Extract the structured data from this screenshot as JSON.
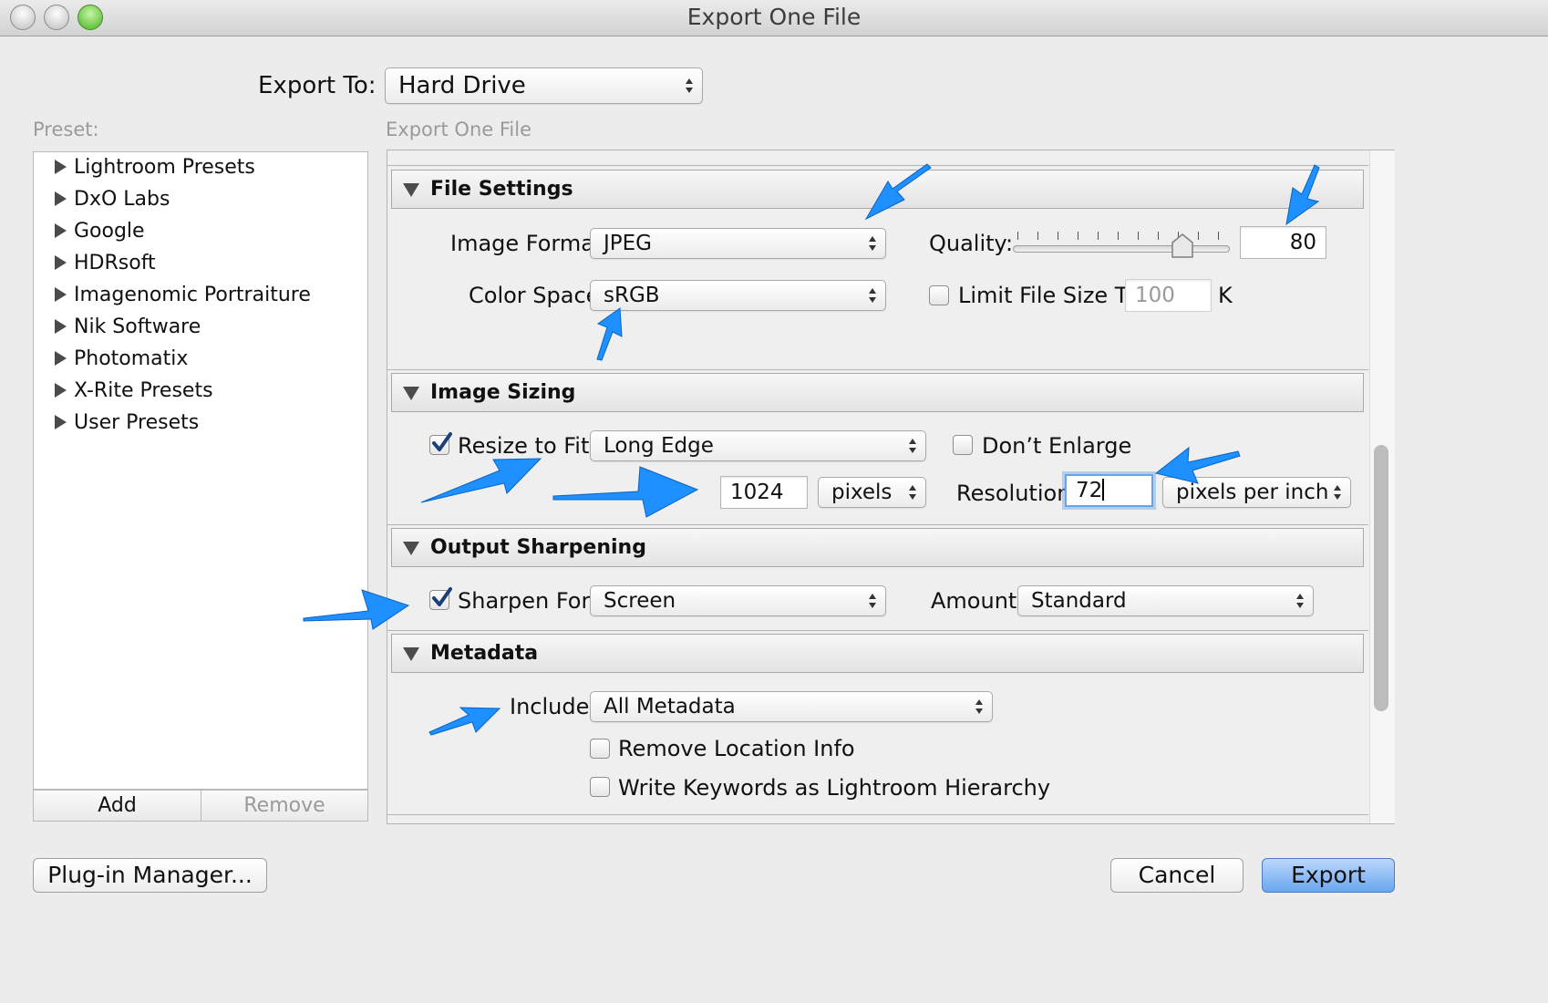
{
  "window": {
    "title": "Export One File"
  },
  "export_to": {
    "label": "Export To:",
    "value": "Hard Drive"
  },
  "preset": {
    "label": "Preset:",
    "items": [
      "Lightroom Presets",
      "DxO Labs",
      "Google",
      "HDRsoft",
      "Imagenomic Portraiture",
      "Nik Software",
      "Photomatix",
      "X-Rite Presets",
      "User Presets"
    ],
    "add_label": "Add",
    "remove_label": "Remove"
  },
  "settings_title": "Export One File",
  "file_settings": {
    "title": "File Settings",
    "image_format_label": "Image Format:",
    "image_format": "JPEG",
    "quality_label": "Quality:",
    "quality": "80",
    "color_space_label": "Color Space:",
    "color_space": "sRGB",
    "limit_label": "Limit File Size To:",
    "limit_value": "100",
    "limit_unit": "K"
  },
  "image_sizing": {
    "title": "Image Sizing",
    "resize_label": "Resize to Fit:",
    "resize_mode": "Long Edge",
    "dont_enlarge_label": "Don’t Enlarge",
    "size_value": "1024",
    "size_unit": "pixels",
    "resolution_label": "Resolution:",
    "resolution_value": "72",
    "resolution_unit": "pixels per inch"
  },
  "output_sharpening": {
    "title": "Output Sharpening",
    "sharpen_label": "Sharpen For:",
    "sharpen_for": "Screen",
    "amount_label": "Amount:",
    "amount": "Standard"
  },
  "metadata": {
    "title": "Metadata",
    "include_label": "Include:",
    "include": "All Metadata",
    "remove_location_label": "Remove Location Info",
    "write_keywords_label": "Write Keywords as Lightroom Hierarchy"
  },
  "footer": {
    "plugin_manager_label": "Plug-in Manager...",
    "cancel_label": "Cancel",
    "export_label": "Export"
  },
  "colors": {
    "annotation_arrow": "#1e90ff",
    "primary_button": "#6aa6f0"
  },
  "quality_slider_value": 0.8
}
